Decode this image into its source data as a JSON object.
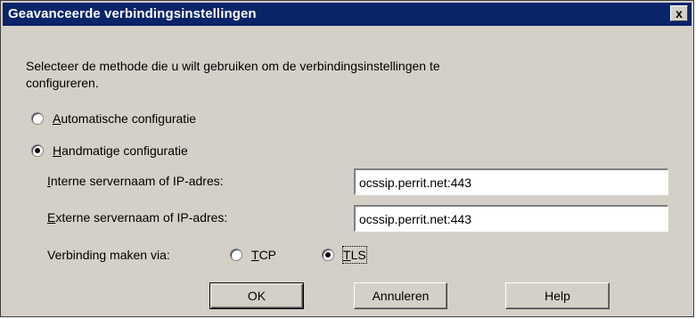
{
  "window": {
    "title": "Geavanceerde verbindingsinstellingen",
    "close_symbol": "x"
  },
  "instructions": {
    "line1": "Selecteer de methode die u wilt gebruiken om de verbindingsinstellingen te",
    "line2": "configureren."
  },
  "radios": {
    "auto": {
      "accesskey": "A",
      "rest": "utomatische configuratie",
      "checked": false
    },
    "manual": {
      "accesskey": "H",
      "rest": "andmatige configuratie",
      "checked": true
    }
  },
  "fields": {
    "internal": {
      "label_accesskey": "I",
      "label_rest": "nterne servernaam of IP-adres:",
      "value": "ocssip.perrit.net:443"
    },
    "external": {
      "label_accesskey": "E",
      "label_rest": "xterne servernaam of IP-adres:",
      "value": "ocssip.perrit.net:443"
    }
  },
  "connection": {
    "label": "Verbinding maken via:",
    "tcp": {
      "accesskey": "T",
      "rest": "CP",
      "checked": false
    },
    "tls": {
      "accesskey": "T",
      "rest": "LS",
      "checked": true
    }
  },
  "buttons": {
    "ok": "OK",
    "cancel": "Annuleren",
    "help": "Help"
  },
  "icons": {
    "close": "close-icon",
    "radio": "radio-icon"
  },
  "colors": {
    "titlebar": "#0a246a",
    "face": "#d4d0c8"
  }
}
